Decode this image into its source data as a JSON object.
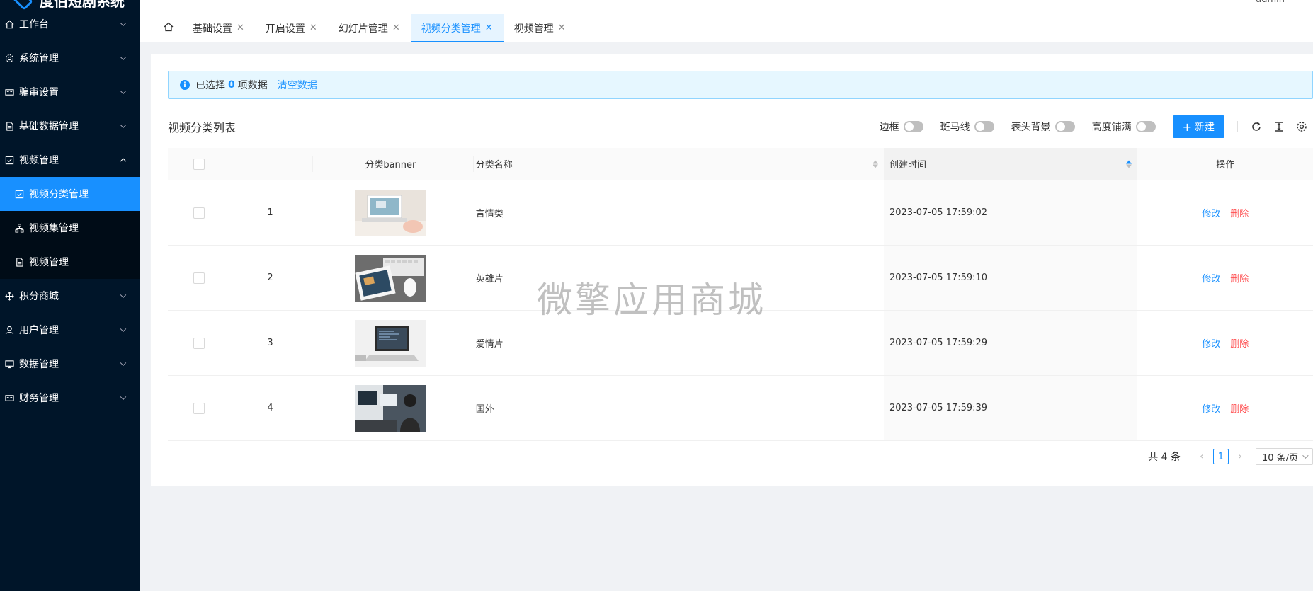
{
  "app": {
    "title": "度伯短剧系统"
  },
  "header": {
    "user": "admin"
  },
  "sidebar": {
    "items": [
      {
        "label": "工作台",
        "icon": "home-icon"
      },
      {
        "label": "系统管理",
        "icon": "gear-icon"
      },
      {
        "label": "骗审设置",
        "icon": "card-icon"
      },
      {
        "label": "基础数据管理",
        "icon": "file-icon"
      },
      {
        "label": "视频管理",
        "icon": "check-square-icon",
        "expanded": true,
        "children": [
          {
            "label": "视频分类管理",
            "icon": "check-square-icon",
            "active": true
          },
          {
            "label": "视频集管理",
            "icon": "cluster-icon"
          },
          {
            "label": "视频管理",
            "icon": "file-icon"
          }
        ]
      },
      {
        "label": "积分商城",
        "icon": "move-icon"
      },
      {
        "label": "用户管理",
        "icon": "user-icon"
      },
      {
        "label": "数据管理",
        "icon": "desktop-icon"
      },
      {
        "label": "财务管理",
        "icon": "card-icon"
      }
    ]
  },
  "tabs": [
    {
      "label": "基础设置"
    },
    {
      "label": "开启设置"
    },
    {
      "label": "幻灯片管理"
    },
    {
      "label": "视频分类管理",
      "active": true
    },
    {
      "label": "视频管理"
    }
  ],
  "alert": {
    "prefix": "已选择",
    "count": "0",
    "suffix": "项数据",
    "clear": "清空数据"
  },
  "toolbar": {
    "title": "视频分类列表",
    "switches": [
      "边框",
      "斑马线",
      "表头背景",
      "高度铺满"
    ],
    "new_label": "新建"
  },
  "table": {
    "columns": {
      "banner": "分类banner",
      "name": "分类名称",
      "time": "创建时间",
      "op": "操作"
    },
    "rows": [
      {
        "idx": "1",
        "name": "言情类",
        "time": "2023-07-05 17:59:02"
      },
      {
        "idx": "2",
        "name": "英雄片",
        "time": "2023-07-05 17:59:10"
      },
      {
        "idx": "3",
        "name": "爱情片",
        "time": "2023-07-05 17:59:29"
      },
      {
        "idx": "4",
        "name": "国外",
        "time": "2023-07-05 17:59:39"
      }
    ],
    "edit_label": "修改",
    "delete_label": "删除"
  },
  "pager": {
    "total": "共 4 条",
    "current": "1",
    "size": "10 条/页"
  },
  "watermark": "微擎应用商城",
  "colors": {
    "primary": "#1890ff",
    "danger": "#ff4d4f",
    "sidebar": "#001529"
  }
}
